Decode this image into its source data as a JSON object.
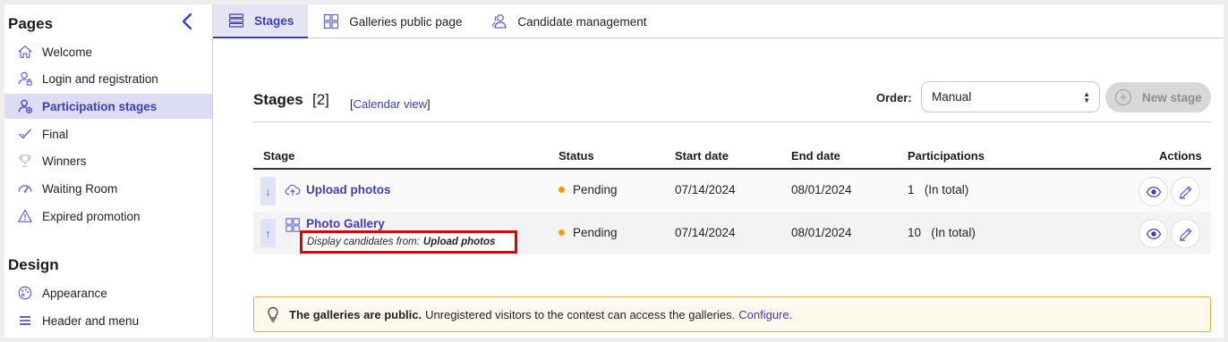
{
  "sidebar": {
    "pages_heading": "Pages",
    "design_heading": "Design",
    "items": [
      {
        "label": "Welcome",
        "icon": "home-icon"
      },
      {
        "label": "Login and registration",
        "icon": "user-lock-icon"
      },
      {
        "label": "Participation stages",
        "icon": "user-stages-icon",
        "active": true
      },
      {
        "label": "Final",
        "icon": "check-icon"
      },
      {
        "label": "Winners",
        "icon": "trophy-icon"
      },
      {
        "label": "Waiting Room",
        "icon": "gauge-icon"
      },
      {
        "label": "Expired promotion",
        "icon": "warning-icon"
      }
    ],
    "design_items": [
      {
        "label": "Appearance",
        "icon": "palette-icon"
      },
      {
        "label": "Header and menu",
        "icon": "menu-icon"
      }
    ]
  },
  "tabs": [
    {
      "label": "Stages",
      "icon": "list-icon",
      "active": true
    },
    {
      "label": "Galleries public page",
      "icon": "grid-icon"
    },
    {
      "label": "Candidate management",
      "icon": "users-icon"
    }
  ],
  "stages": {
    "title": "Stages",
    "count": "[2]",
    "calendar_open": "[",
    "calendar_link": "Calendar view",
    "calendar_close": "]",
    "order_label": "Order:",
    "order_value": "Manual",
    "new_stage_label": "New stage",
    "columns": [
      "Stage",
      "Status",
      "Start date",
      "End date",
      "Participations",
      "Actions"
    ],
    "rows": [
      {
        "sort": "↓",
        "icon": "cloud-upload-icon",
        "name": "Upload photos",
        "status": "Pending",
        "start": "07/14/2024",
        "end": "08/01/2024",
        "participations": "1",
        "participations_note": "(In total)"
      },
      {
        "sort": "↑",
        "icon": "gallery-icon",
        "name": "Photo Gallery",
        "display_from_label": "Display candidates from:",
        "display_from_value": "Upload photos",
        "status": "Pending",
        "start": "07/14/2024",
        "end": "08/01/2024",
        "participations": "10",
        "participations_note": "(In total)"
      }
    ]
  },
  "notice": {
    "bold": "The galleries are public.",
    "text": "Unregistered visitors to the contest can access the galleries.",
    "link": "Configure",
    "end": "."
  },
  "colors": {
    "accent": "#3b3fb6",
    "pending": "#f39c12",
    "highlight": "#e00000",
    "notice_border": "#f0a53c"
  }
}
